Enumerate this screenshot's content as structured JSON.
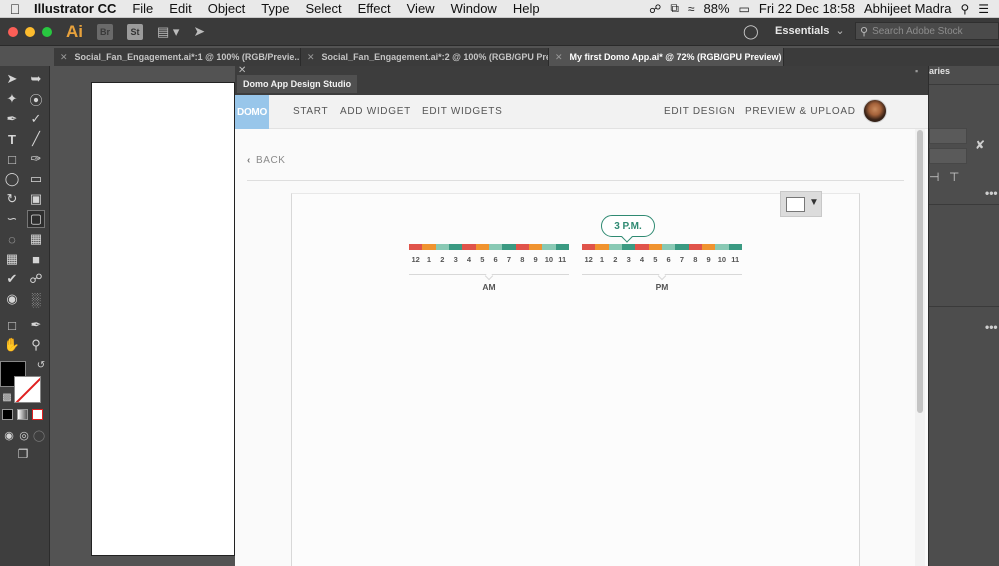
{
  "menubar": {
    "apple_icon": "apple-icon",
    "items": [
      "Illustrator CC",
      "File",
      "Edit",
      "Object",
      "Type",
      "Select",
      "Effect",
      "View",
      "Window",
      "Help"
    ],
    "battery": "88%",
    "datetime": "Fri 22 Dec  18:58",
    "user": "Abhijeet Madra"
  },
  "appbar": {
    "logo": "Ai",
    "bridge_icon": "Br",
    "stock_icon": "St",
    "workspace": "Essentials",
    "search_placeholder": "Search Adobe Stock"
  },
  "doc_tabs": [
    {
      "label": "Social_Fan_Engagement.ai*:1 @ 100% (RGB/Previe...",
      "active": false
    },
    {
      "label": "Social_Fan_Engagement.ai*:2 @ 100% (RGB/GPU Preview...",
      "active": false
    },
    {
      "label": "My first Domo App.ai* @ 72% (RGB/GPU Preview)",
      "active": true
    }
  ],
  "right_panel": {
    "partial_label": "aries"
  },
  "studio": {
    "window_title": "Domo App Design Studio",
    "logo": "DOMO",
    "nav_left": [
      "START",
      "ADD WIDGET",
      "EDIT WIDGETS"
    ],
    "nav_right": [
      "EDIT DESIGN",
      "PREVIEW & UPLOAD"
    ],
    "back_label": "BACK",
    "time_picker": {
      "selected_label": "3 P.M.",
      "hours": [
        "12",
        "1",
        "2",
        "3",
        "4",
        "5",
        "6",
        "7",
        "8",
        "9",
        "10",
        "11"
      ],
      "am_label": "AM",
      "pm_label": "PM",
      "segment_colors": [
        "#e0534a",
        "#f0932f",
        "#89c9b4",
        "#3a9a82",
        "#e0534a",
        "#f0932f",
        "#89c9b4",
        "#3a9a82",
        "#e0534a",
        "#f0932f",
        "#89c9b4",
        "#3a9a82"
      ],
      "selected_color": "#2f8a72"
    }
  }
}
